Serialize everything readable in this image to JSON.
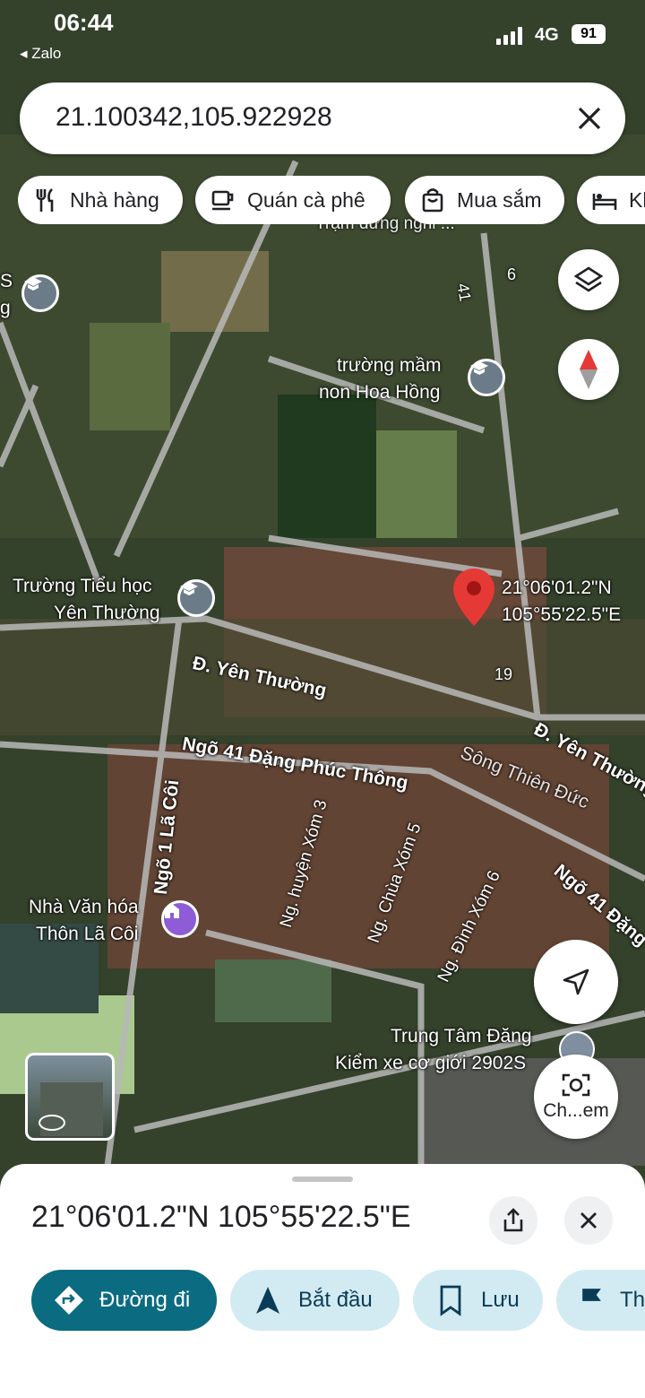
{
  "status": {
    "time": "06:44",
    "back_app": "◂ Zalo",
    "network": "4G",
    "battery": "91"
  },
  "search": {
    "query": "21.100342,105.922928",
    "clear_icon": "close-icon"
  },
  "chips": [
    {
      "label": "Nhà hàng",
      "icon": "restaurant-icon"
    },
    {
      "label": "Quán cà phê",
      "icon": "coffee-icon"
    },
    {
      "label": "Mua sắm",
      "icon": "shopping-bag-icon"
    },
    {
      "label": "Kh",
      "icon": "hotel-icon"
    }
  ],
  "map_labels": {
    "tram": "Trạm dừng nghỉ ...",
    "kindergarten_1": "trường mầm",
    "kindergarten_2": "non Hoa Hồng",
    "primary_1": "Trường Tiểu học",
    "primary_2": "Yên Thường",
    "pin_lat": "21°06'01.2\"N",
    "pin_lng": "105°55'22.5\"E",
    "road_yen_thuong": "Đ. Yên Thường",
    "road_yen_thuong_2": "Đ. Yên Thường",
    "ngo41": "Ngõ 41 Đặng Phúc Thông",
    "ngo41_b": "Ngõ 41 Đặng",
    "song": "Sông Thiên Đức",
    "ngo1": "Ngõ 1 Lã Côi",
    "huyen": "Ng. huyện Xóm 3",
    "chua": "Ng. Chùa Xóm 5",
    "dinh": "Ng. Đình Xóm 6",
    "house_1": "Nhà Văn hóa",
    "house_2": "Thôn Lã Côi",
    "center_1": "Trung Tâm Đăng",
    "center_2": "Kiểm xe cơ giới 2902S",
    "num_19": "19",
    "num_41": "41",
    "num_6": "6",
    "s_edge": "S",
    "g_edge": "g"
  },
  "fabs": {
    "layers": "layers-icon",
    "compass": "compass-icon",
    "locate": "navigation-icon",
    "lens_label": "Ch...em"
  },
  "sheet": {
    "coordinates": "21°06'01.2\"N 105°55'22.5\"E",
    "share_icon": "share-icon",
    "close_icon": "close-icon",
    "actions": [
      {
        "label": "Đường đi",
        "icon": "directions-icon"
      },
      {
        "label": "Bắt đầu",
        "icon": "navigate-arrow-icon"
      },
      {
        "label": "Lưu",
        "icon": "bookmark-icon"
      },
      {
        "label": "Th",
        "icon": "flag-icon"
      }
    ]
  },
  "colors": {
    "accent": "#0b6b80",
    "action_bg": "#d2ebf2",
    "pin": "#e53935"
  }
}
